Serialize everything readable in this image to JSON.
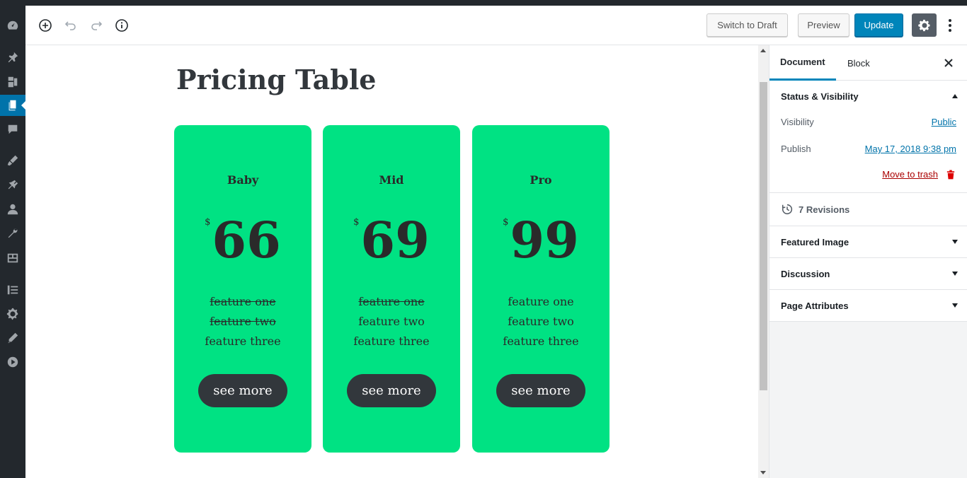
{
  "header": {
    "switch_draft": "Switch to Draft",
    "preview": "Preview",
    "update": "Update"
  },
  "page": {
    "title": "Pricing Table"
  },
  "cards": [
    {
      "plan": "Baby",
      "currency": "$",
      "price": "66",
      "features": [
        "feature one",
        "feature two",
        "feature three"
      ],
      "button": "see more"
    },
    {
      "plan": "Mid",
      "currency": "$",
      "price": "69",
      "features": [
        "feature one",
        "feature two",
        "feature three"
      ],
      "button": "see more"
    },
    {
      "plan": "Pro",
      "currency": "$",
      "price": "99",
      "features": [
        "feature one",
        "feature two",
        "feature three"
      ],
      "button": "see more"
    }
  ],
  "sidebar": {
    "tabs": [
      "Document",
      "Block"
    ],
    "status_title": "Status & Visibility",
    "visibility_label": "Visibility",
    "visibility_value": "Public",
    "publish_label": "Publish",
    "publish_value": "May 17, 2018 9:38 pm",
    "trash": "Move to trash",
    "revisions": "7 Revisions",
    "featured_image": "Featured Image",
    "discussion": "Discussion",
    "page_attributes": "Page Attributes"
  },
  "colors": {
    "card": "#00e283",
    "button_dark": "#32373c",
    "primary": "#0085ba",
    "admin_bar": "#23282d"
  }
}
